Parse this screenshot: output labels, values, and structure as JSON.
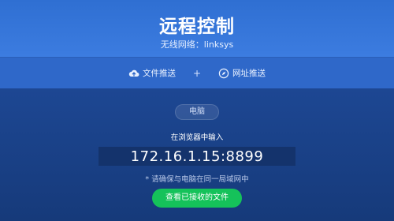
{
  "header": {
    "title": "远程控制",
    "subtitle": "无线网络：linksys"
  },
  "toolbar": {
    "file_push": {
      "label": "文件推送",
      "icon": "cloud-upload-icon"
    },
    "separator": "+",
    "url_push": {
      "label": "网址推送",
      "icon": "compass-icon"
    }
  },
  "main": {
    "device_tab": "电脑",
    "hint": "在浏览器中输入",
    "address": "172.16.1.15:8899",
    "note_mark": "*",
    "note": "请确保与电脑在同一局域网中",
    "view_button": "查看已接收的文件"
  },
  "colors": {
    "header_bg": "#3c7ce0",
    "toolbar_bg": "#2f68c9",
    "main_bg": "#163a7a",
    "button_green": "#15c25a"
  }
}
